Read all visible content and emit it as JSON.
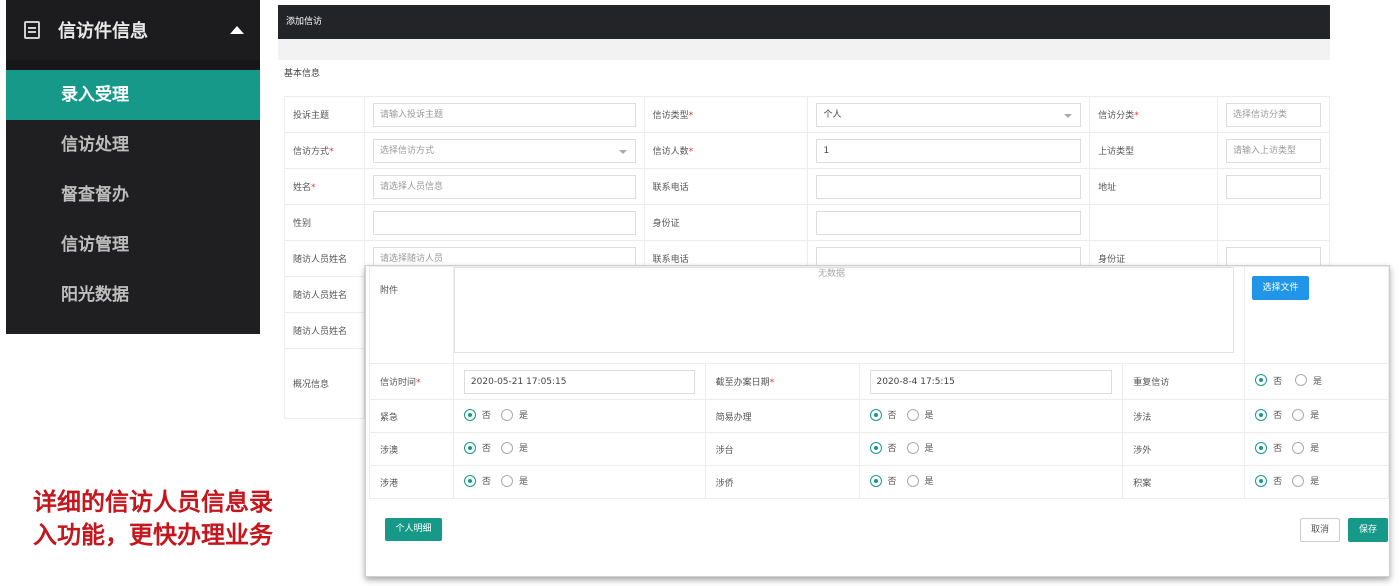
{
  "sidebar": {
    "title": "信访件信息",
    "items": [
      {
        "label": "录入受理",
        "active": true
      },
      {
        "label": "信访处理"
      },
      {
        "label": "督查督办"
      },
      {
        "label": "信访管理"
      },
      {
        "label": "阳光数据"
      }
    ]
  },
  "form": {
    "header": "添加信访",
    "section": "基本信息",
    "rows": {
      "r1": {
        "l1": "投诉主题",
        "p1": "请输入投诉主题",
        "l2": "信访类型",
        "v2": "个人",
        "l3": "信访分类",
        "p3": "选择信访分类"
      },
      "r2": {
        "l1": "信访方式",
        "p1": "选择信访方式",
        "l2": "信访人数",
        "v2": "1",
        "l3": "上访类型",
        "p3": "请输入上访类型"
      },
      "r3": {
        "l1": "姓名",
        "p1": "请选择人员信息",
        "l2": "联系电话",
        "l3": "地址"
      },
      "r4": {
        "l1": "性别",
        "l2": "身份证"
      },
      "r5": {
        "l1": "随访人员姓名",
        "p1": "请选择随访人员",
        "l2": "联系电话",
        "l3": "身份证"
      },
      "r6": {
        "l1": "随访人员姓名"
      },
      "r7": {
        "l1": "随访人员姓名"
      },
      "r8": {
        "l1": "概况信息"
      }
    },
    "required_mark": "*"
  },
  "overlay": {
    "attach_label": "附件",
    "no_data": "无数据",
    "select_file": "选择文件",
    "visit_time_label": "信访时间",
    "visit_time": "2020-05-21 17:05:15",
    "deadline_label": "截至办案日期",
    "deadline": "2020-8-4 17:5:15",
    "repeat_label": "重复信访",
    "flags": [
      [
        "紧急",
        "简易办理",
        "涉法"
      ],
      [
        "涉澳",
        "涉台",
        "涉外"
      ],
      [
        "涉港",
        "涉侨",
        "积案"
      ]
    ],
    "no": "否",
    "yes": "是",
    "btn_person": "个人明细",
    "btn_cancel": "取消",
    "btn_save": "保存"
  },
  "caption": {
    "line1": "详细的信访人员信息录",
    "line2": "入功能，更快办理业务"
  },
  "colors": {
    "accent": "#17998a",
    "blue": "#2196e8",
    "caption": "#c4161c",
    "dark": "#222428"
  }
}
